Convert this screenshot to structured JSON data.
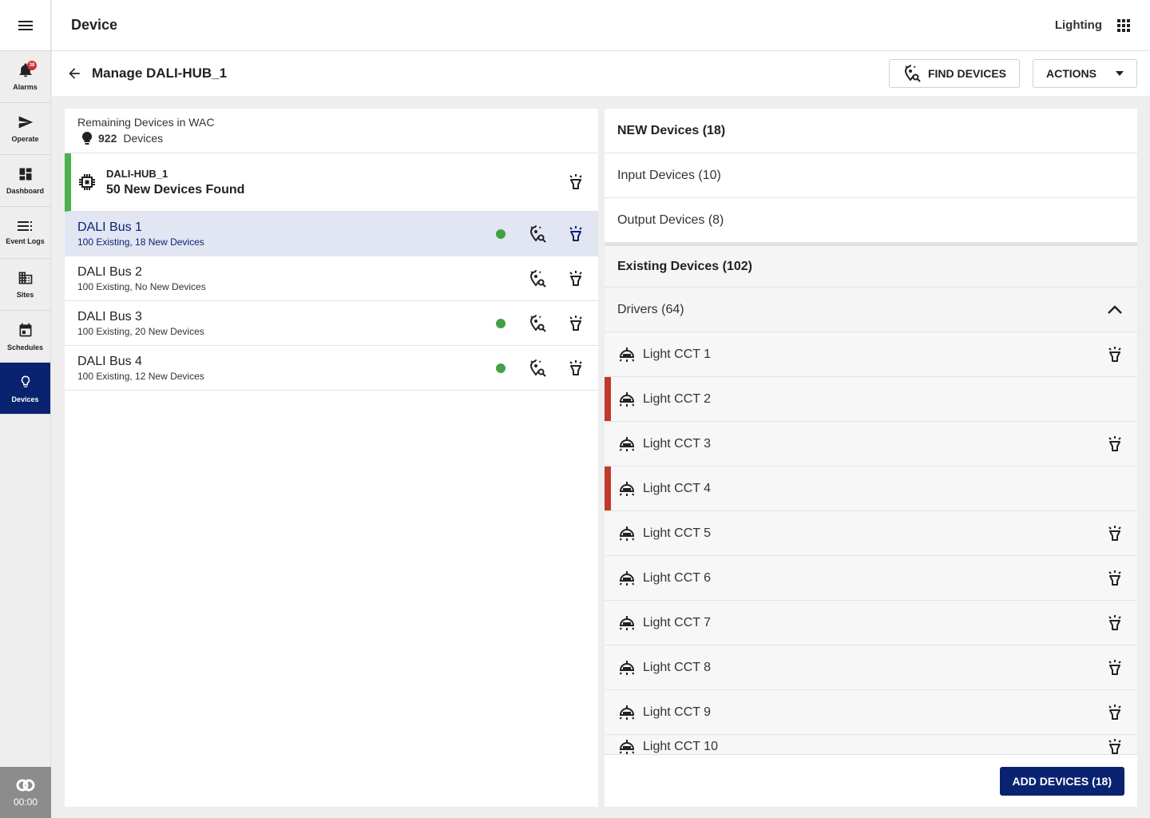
{
  "nav": {
    "items": [
      {
        "label": "Alarms",
        "icon": "bell-icon",
        "badge": "38"
      },
      {
        "label": "Operate",
        "icon": "send-icon"
      },
      {
        "label": "Dashboard",
        "icon": "dashboard-icon"
      },
      {
        "label": "Event Logs",
        "icon": "list-icon"
      },
      {
        "label": "Sites",
        "icon": "building-icon"
      },
      {
        "label": "Schedules",
        "icon": "calendar-icon"
      },
      {
        "label": "Devices",
        "icon": "bulb-icon",
        "active": true
      }
    ],
    "timer": "00:00"
  },
  "header": {
    "title": "Device",
    "app_label": "Lighting"
  },
  "subheader": {
    "title": "Manage DALI-HUB_1",
    "find_devices_label": "FIND DEVICES",
    "actions_label": "ACTIONS"
  },
  "left": {
    "remaining_label": "Remaining Devices in WAC",
    "remaining_count": "922",
    "remaining_unit": "Devices",
    "hub": {
      "name": "DALI-HUB_1",
      "status": "50 New Devices Found"
    },
    "buses": [
      {
        "name": "DALI Bus 1",
        "meta": "100 Existing, 18 New Devices",
        "has_new": true,
        "selected": true
      },
      {
        "name": "DALI Bus 2",
        "meta": "100 Existing, No New Devices",
        "has_new": false,
        "selected": false
      },
      {
        "name": "DALI Bus 3",
        "meta": "100 Existing, 20 New Devices",
        "has_new": true,
        "selected": false
      },
      {
        "name": "DALI Bus 4",
        "meta": "100 Existing, 12 New Devices",
        "has_new": true,
        "selected": false
      }
    ]
  },
  "right": {
    "new_devices_label": "NEW Devices (18)",
    "input_devices_label": "Input Devices (10)",
    "output_devices_label": "Output Devices (8)",
    "existing_devices_label": "Existing Devices (102)",
    "drivers_label": "Drivers (64)",
    "drivers": [
      {
        "name": "Light CCT 1",
        "error": false
      },
      {
        "name": "Light CCT 2",
        "error": true
      },
      {
        "name": "Light CCT 3",
        "error": false
      },
      {
        "name": "Light CCT 4",
        "error": true
      },
      {
        "name": "Light CCT 5",
        "error": false
      },
      {
        "name": "Light CCT 6",
        "error": false
      },
      {
        "name": "Light CCT 7",
        "error": false
      },
      {
        "name": "Light CCT 8",
        "error": false
      },
      {
        "name": "Light CCT 9",
        "error": false
      },
      {
        "name": "Light CCT 10",
        "error": false
      }
    ],
    "add_button_label": "ADD DEVICES (18)"
  },
  "colors": {
    "primary": "#0a2370",
    "success": "#43a047",
    "error": "#c0392b",
    "hub_accent": "#4caf50"
  }
}
